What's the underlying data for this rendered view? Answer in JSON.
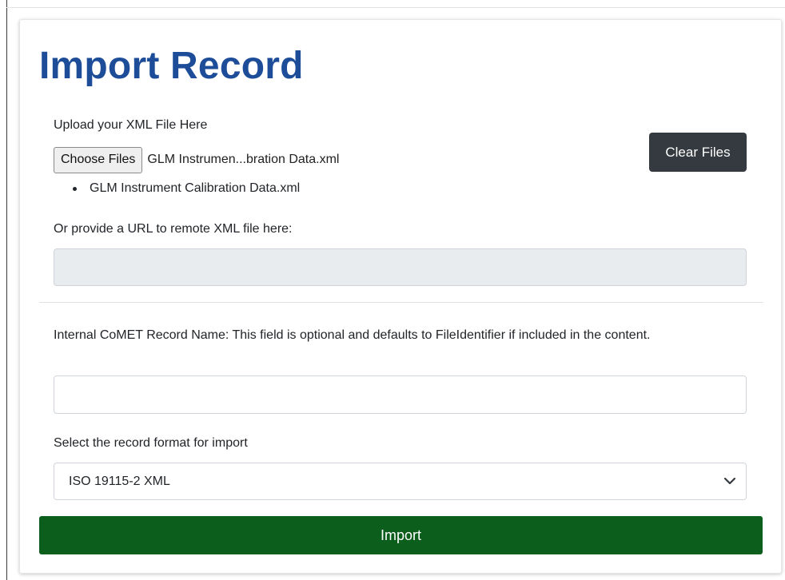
{
  "page": {
    "title": "Import Record"
  },
  "upload": {
    "label": "Upload your XML File Here",
    "choose_label": "Choose Files",
    "chosen_file_display": "GLM Instrumen...bration Data.xml",
    "clear_label": "Clear Files",
    "files": [
      "GLM Instrument Calibration Data.xml"
    ]
  },
  "url": {
    "label": "Or provide a URL to remote XML file here:",
    "value": "",
    "placeholder": ""
  },
  "record_name": {
    "label": "Internal CoMET Record Name: This field is optional and defaults to FileIdentifier if included in the content.",
    "value": ""
  },
  "format": {
    "label": "Select the record format for import",
    "selected": "ISO 19115-2 XML"
  },
  "actions": {
    "import_label": "Import"
  },
  "colors": {
    "title": "#1d4d99",
    "clear_button": "#343a40",
    "import_button": "#0c5e1d",
    "disabled_input": "#e9ecef"
  },
  "icons": {
    "select_arrow": "chevron-down-icon"
  }
}
